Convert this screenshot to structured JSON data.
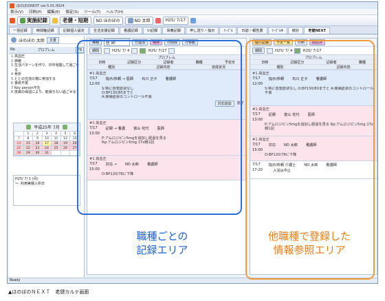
{
  "window": {
    "title": "ほのぼのNEXT  ver.5.01.0024"
  },
  "menu": [
    "表示(V)",
    "印刷(P)",
    "編集(E)",
    "設定(S)",
    "ツール(T)",
    "ヘルプ(H)"
  ],
  "toolbar": {
    "record": "実施記録",
    "facility": "老健・短期",
    "client_id": "ND ほのぼの",
    "staff": "ND 太郎",
    "date": "H25/ 7/17"
  },
  "tabs": [
    "一括記録",
    "時間軸記録",
    "記録個人設定",
    "生活支援記録",
    "看護記録",
    "ﾘﾊ記録",
    "栄養記録",
    "申し送り・指示",
    "ﾃｰﾌﾞﾙ",
    "日誌・報告書",
    "ﾃｰﾌﾞﾙ4",
    "統計",
    "老健NEXT"
  ],
  "patient": {
    "name": "ほのぼの 太郎",
    "button": "文書"
  },
  "problems": {
    "header_no": "No",
    "header_title": "プロブレム",
    "header_btn": "F8",
    "items": [
      [
        "1",
        "高血圧"
      ],
      [
        "2",
        "褥瘡"
      ],
      [
        "3",
        "生活パターンを作り、日中覚醒して過ごせる"
      ],
      [
        "4",
        "骨折"
      ],
      [
        "5",
        "ととの交流の場に参加する"
      ],
      [
        "6",
        "食欲不振"
      ],
      [
        "7",
        "Key person不在"
      ],
      [
        "8",
        "皮膚の保湿により、乾燥ちない過ごせる"
      ]
    ]
  },
  "calendar": {
    "title": "平成25年 7月",
    "rows": [
      [
        "",
        "1",
        "2",
        "3",
        "4",
        "5",
        "6"
      ],
      [
        "7",
        "8",
        "9",
        "10",
        "11",
        "12",
        "13"
      ],
      [
        "14",
        "15",
        "16",
        "17",
        "18",
        "19",
        "20"
      ],
      [
        "21",
        "22",
        "23",
        "24",
        "25",
        "26",
        "27"
      ],
      [
        "28",
        "29",
        "30",
        "31",
        "",
        "",
        ""
      ]
    ]
  },
  "schedule": {
    "date": "H25/ 7/ 1 (月)",
    "time": "〜",
    "note": "利用実績入所日"
  },
  "mid": {
    "job": "医 師",
    "pills": [
      "行連加",
      "保存",
      "行削除",
      "行移動"
    ],
    "date_from": "H25/ 7/ 4",
    "date_to": "H25/ 7/17",
    "headers": {
      "problem": "プロブレム",
      "day": "日時",
      "cat": "記録区分",
      "recorder": "記録者",
      "job": "職種",
      "plan": "予定日",
      "kind": "種別",
      "content": "記録内容",
      "status": "達成状況"
    },
    "records": [
      {
        "problem": "#1  高血圧",
        "date": "7/17",
        "cat": "指示/依頼 → 医師",
        "who": "石川 正子",
        "job": "看護師",
        "time": "12:00",
        "note1": "S:特に自覚症状なし",
        "note2": "O:BP130/80までと",
        "note3": "A:疾病症状のコントロール不良",
        "btn": "対応追加",
        "done": "完了"
      },
      {
        "problem": "#1  高血圧",
        "date": "7/17",
        "cat": "記録 → 看護",
        "who": "富山 花代",
        "job": "医師",
        "time": "13:00",
        "note1": "P:アムロジピン5mgを追加し経過を見る",
        "note2": "Rp:アムロジピン5mg  1Tx朝1回",
        "note3": "",
        "btn": "",
        "done": ""
      },
      {
        "problem": "#1  高血圧",
        "date": "7/17",
        "cat": "対応 →",
        "who": "ND 太郎",
        "job": "看護師",
        "time": "15:00",
        "note1": "O:BP120/78に下降",
        "note2": "",
        "note3": "",
        "btn": "",
        "done": ""
      }
    ]
  },
  "right": {
    "pills": [
      "個人記録",
      "予定一覧",
      "印刷",
      "閉込み"
    ],
    "date_from": "H25/ 7/ 4",
    "date_to": "H25/ 7/17",
    "records": [
      {
        "problem": "#1  高血圧",
        "date": "7/17",
        "cat": "指示/依頼",
        "who": "石川 正子",
        "job": "看護師",
        "time": "12:00",
        "note": "S:特に自覚症状なし O:BP130/80までと A:疾病症状のコントロール不良"
      },
      {
        "problem": "#1  高血圧",
        "date": "7/17",
        "cat": "記録",
        "who": "富山 花代",
        "job": "医師",
        "time": "13:00",
        "note": "P:アムロジピン5mgを追加し経過を見る Rp:アムロジピン5mg 1Tx朝1回"
      },
      {
        "problem": "#1  高血圧",
        "date": "7/17",
        "cat": "対応",
        "who": "ND 太郎",
        "job": "看護師",
        "time": "15:00",
        "note": "O:BP120/78に下降"
      },
      {
        "problem": "",
        "date": "7/17",
        "cat": "指示/依頼  介護士",
        "who": "ND 太郎",
        "job": "看護師",
        "time": "17:20",
        "note": "入浴は中止"
      }
    ]
  },
  "captions": {
    "blue_1": "職種ごとの",
    "blue_2": "記録エリア",
    "orange_1": "他職種で登録した",
    "orange_2": "情報参照エリア"
  },
  "status": "Ready",
  "footer": "▲ほのぼのＮＥＸＴ　老健カルテ画面",
  "colors": {
    "blue": "#2b6ed6",
    "orange": "#ef9b3c"
  }
}
